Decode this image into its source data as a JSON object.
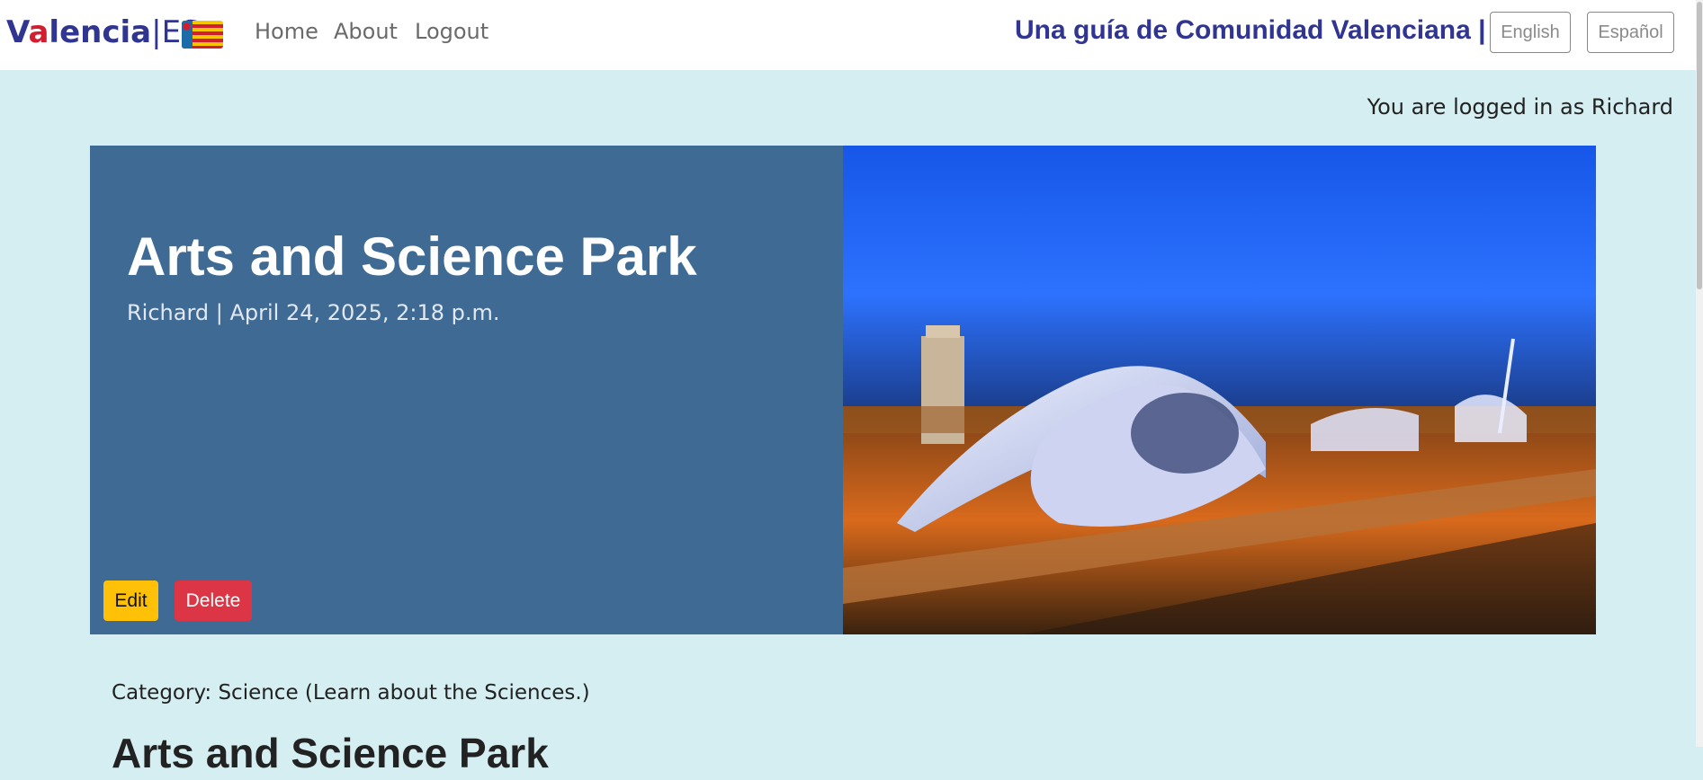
{
  "navbar": {
    "brand_main_v": "V",
    "brand_main_a": "a",
    "brand_main_rest": "lencia",
    "brand_separator": "|",
    "brand_suffix": "ES",
    "links": [
      "Home",
      "About",
      "Logout"
    ],
    "tagline": "Una guía de Comunidad Valenciana  |",
    "languages": [
      "English",
      "Español"
    ]
  },
  "status": {
    "logged_in": "You are logged in as Richard"
  },
  "post": {
    "title": "Arts and Science Park",
    "meta": "Richard | April 24, 2025, 2:18 p.m.",
    "edit_label": "Edit",
    "delete_label": "Delete",
    "category": "Category: Science (Learn about the Sciences.)",
    "content_title": "Arts and Science Park"
  },
  "colors": {
    "page_bg": "#d4eef1",
    "brand": "#2f3590",
    "hero_bg": "#3f6a94",
    "edit_btn": "#ffc107",
    "delete_btn": "#dc3545"
  },
  "icons": {
    "flag": "valencia-flag-icon"
  }
}
